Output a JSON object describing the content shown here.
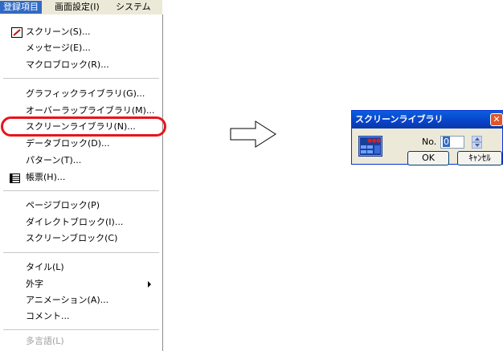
{
  "menubar": {
    "items": [
      {
        "label": "登録項目",
        "active": true
      },
      {
        "label": "画面設定(I)"
      },
      {
        "label": "システム"
      }
    ]
  },
  "menu": {
    "items": [
      {
        "label": "スクリーン(S)...",
        "icon": "screen-edit-icon"
      },
      {
        "label": "メッセージ(E)..."
      },
      {
        "label": "マクロブロック(R)..."
      },
      {
        "label": "グラフィックライブラリ(G)..."
      },
      {
        "label": "オーバーラップライブラリ(M)..."
      },
      {
        "label": "スクリーンライブラリ(N)...",
        "highlighted": true
      },
      {
        "label": "データブロック(D)..."
      },
      {
        "label": "パターン(T)..."
      },
      {
        "label": "帳票(H)...",
        "icon": "report-table-icon"
      },
      {
        "label": "ページブロック(P)"
      },
      {
        "label": "ダイレクトブロック(I)..."
      },
      {
        "label": "スクリーンブロック(C)"
      },
      {
        "label": "タイル(L)"
      },
      {
        "label": "外字",
        "submenu": true
      },
      {
        "label": "アニメーション(A)..."
      },
      {
        "label": "コメント..."
      },
      {
        "label": "多言語(L)",
        "disabled": true
      }
    ]
  },
  "dialog": {
    "title": "スクリーンライブラリ",
    "no_label": "No.",
    "no_value": "0",
    "ok_label": "OK",
    "cancel_label": "ｷｬﾝｾﾙ"
  },
  "colors": {
    "highlight": "#e8141c",
    "title_bar": "#0a5fe0",
    "selection": "#316ac5"
  }
}
